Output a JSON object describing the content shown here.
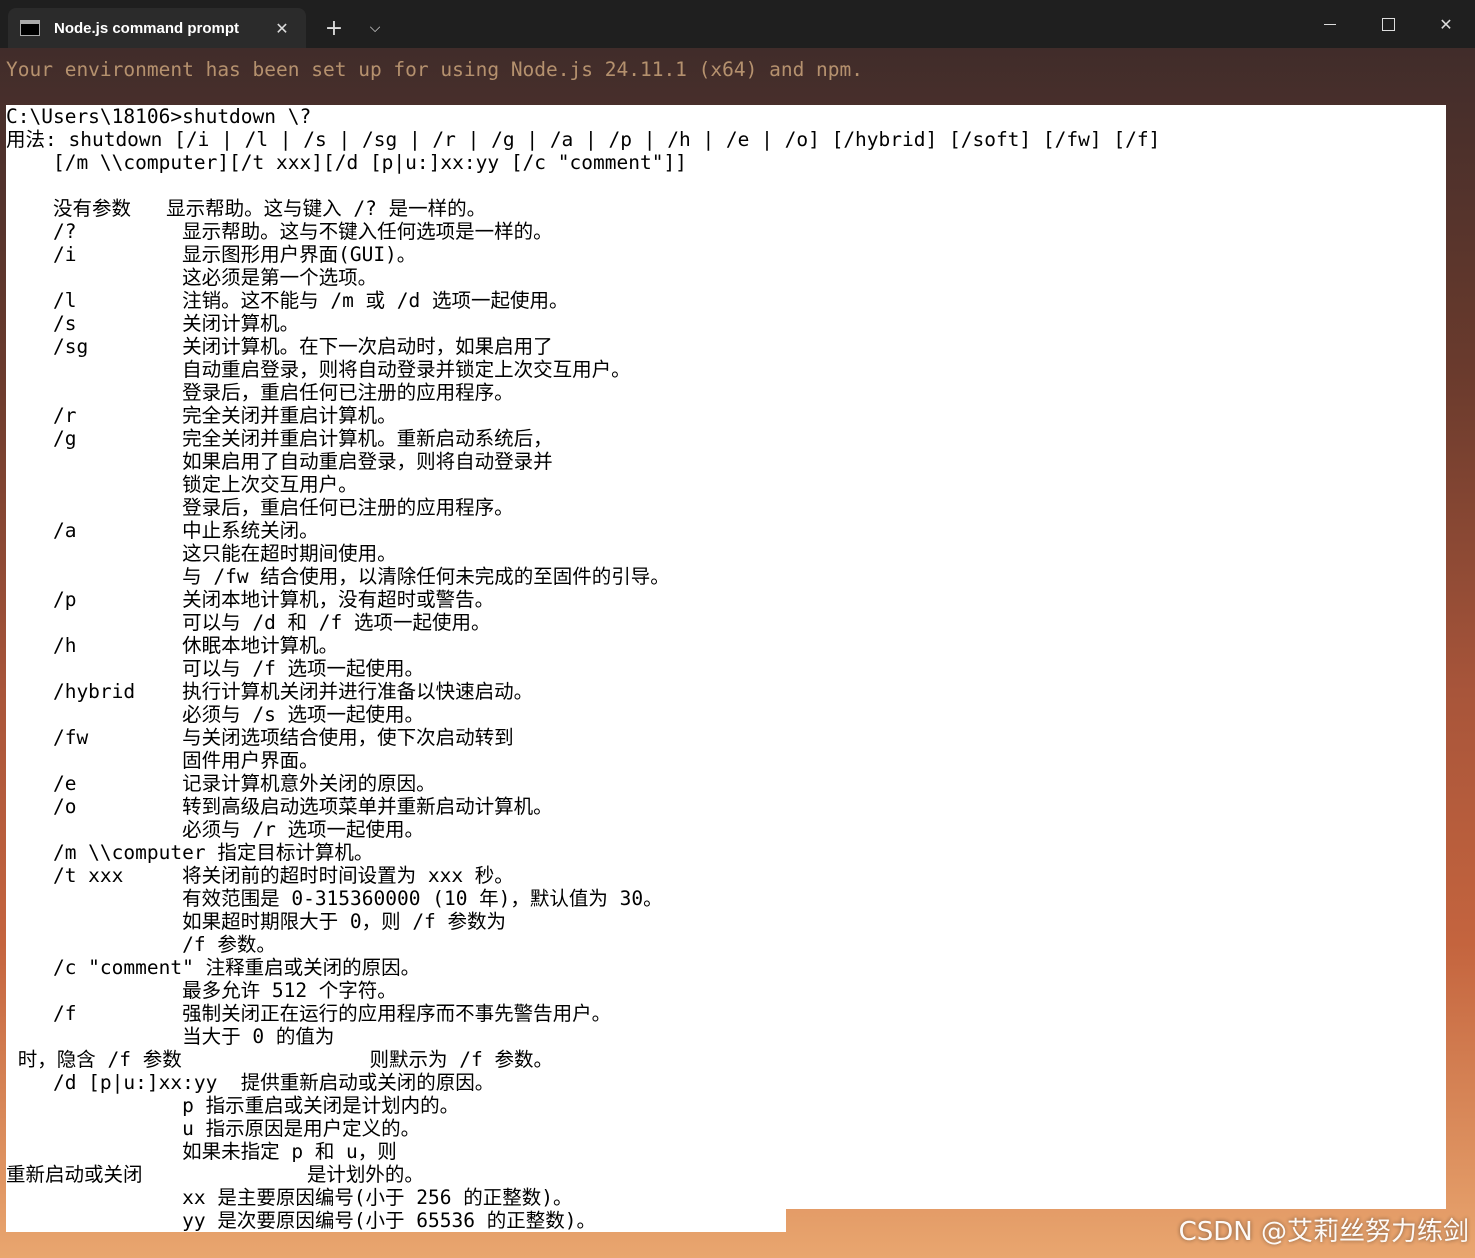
{
  "window": {
    "tab_title": "Node.js command prompt",
    "tab_close": "✕",
    "new_tab": "+",
    "dropdown": "⌵",
    "minimize": "",
    "maximize": "",
    "close": "✕"
  },
  "terminal": {
    "env_line": "Your environment has been set up for using Node.js 24.11.1 (x64) and npm.",
    "lines": [
      "C:\\Users\\18106>shutdown \\?",
      "用法: shutdown [/i | /l | /s | /sg | /r | /g | /a | /p | /h | /e | /o] [/hybrid] [/soft] [/fw] [/f]",
      "    [/m \\\\computer][/t xxx][/d [p|u:]xx:yy [/c \"comment\"]]",
      "",
      "    没有参数   显示帮助。这与键入 /? 是一样的。",
      "    /?         显示帮助。这与不键入任何选项是一样的。",
      "    /i         显示图形用户界面(GUI)。",
      "               这必须是第一个选项。",
      "    /l         注销。这不能与 /m 或 /d 选项一起使用。",
      "    /s         关闭计算机。",
      "    /sg        关闭计算机。在下一次启动时，如果启用了",
      "               自动重启登录，则将自动登录并锁定上次交互用户。",
      "               登录后，重启任何已注册的应用程序。",
      "    /r         完全关闭并重启计算机。",
      "    /g         完全关闭并重启计算机。重新启动系统后，",
      "               如果启用了自动重启登录，则将自动登录并",
      "               锁定上次交互用户。",
      "               登录后，重启任何已注册的应用程序。",
      "    /a         中止系统关闭。",
      "               这只能在超时期间使用。",
      "               与 /fw 结合使用，以清除任何未完成的至固件的引导。",
      "    /p         关闭本地计算机，没有超时或警告。",
      "               可以与 /d 和 /f 选项一起使用。",
      "    /h         休眠本地计算机。",
      "               可以与 /f 选项一起使用。",
      "    /hybrid    执行计算机关闭并进行准备以快速启动。",
      "               必须与 /s 选项一起使用。",
      "    /fw        与关闭选项结合使用，使下次启动转到",
      "               固件用户界面。",
      "    /e         记录计算机意外关闭的原因。",
      "    /o         转到高级启动选项菜单并重新启动计算机。",
      "               必须与 /r 选项一起使用。",
      "    /m \\\\computer 指定目标计算机。",
      "    /t xxx     将关闭前的超时时间设置为 xxx 秒。",
      "               有效范围是 0-315360000 (10 年)，默认值为 30。",
      "               如果超时期限大于 0，则 /f 参数为",
      "               /f 参数。",
      "    /c \"comment\" 注释重启或关闭的原因。",
      "               最多允许 512 个字符。",
      "    /f         强制关闭正在运行的应用程序而不事先警告用户。",
      "               当大于 0 的值为",
      " 时，隐含 /f 参数                则默示为 /f 参数。",
      "    /d [p|u:]xx:yy  提供重新启动或关闭的原因。",
      "               p 指示重启或关闭是计划内的。",
      "               u 指示原因是用户定义的。",
      "               如果未指定 p 和 u，则",
      "重新启动或关闭              是计划外的。",
      "               xx 是主要原因编号(小于 256 的正整数)。",
      "               yy 是次要原因编号(小于 65536 的正整数)。"
    ]
  },
  "watermark": "CSDN @艾莉丝努力练剑"
}
